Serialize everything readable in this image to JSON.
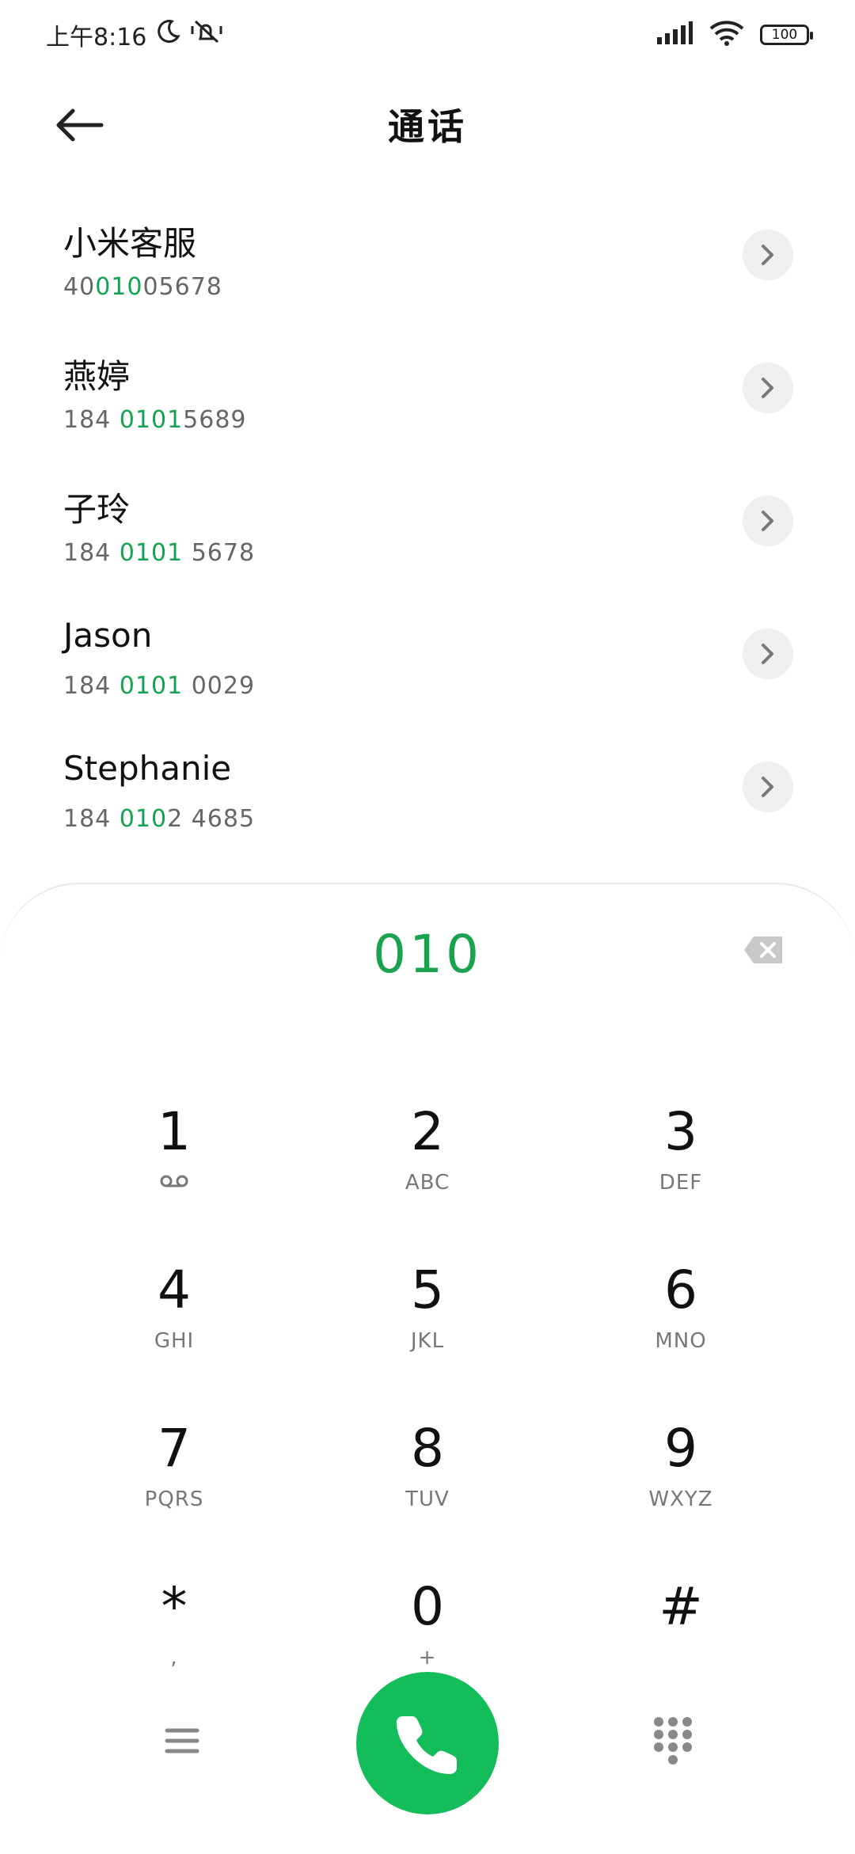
{
  "status_bar": {
    "time": "上午8:16",
    "battery": "100",
    "icons": [
      "moon-icon",
      "mute-icon",
      "signal-icon",
      "wifi-icon",
      "battery-icon"
    ]
  },
  "header": {
    "title": "通话"
  },
  "contacts": [
    {
      "name": "小米客服",
      "number_pre": "40",
      "number_match": "010",
      "number_post": "05678"
    },
    {
      "name": "燕婷",
      "number_pre": "184 ",
      "number_match": "0101",
      "number_post": "5689"
    },
    {
      "name": "子玲",
      "number_pre": "184 ",
      "number_match": "0101",
      "number_post": " 5678"
    },
    {
      "name": "Jason",
      "number_pre": "184 ",
      "number_match": "0101",
      "number_post": " 0029"
    },
    {
      "name": "Stephanie",
      "number_pre": "184 ",
      "number_match": "010",
      "number_post": "2 4685"
    }
  ],
  "dialpad": {
    "input": "010",
    "keys": [
      {
        "digit": "1",
        "letters": ""
      },
      {
        "digit": "2",
        "letters": "ABC"
      },
      {
        "digit": "3",
        "letters": "DEF"
      },
      {
        "digit": "4",
        "letters": "GHI"
      },
      {
        "digit": "5",
        "letters": "JKL"
      },
      {
        "digit": "6",
        "letters": "MNO"
      },
      {
        "digit": "7",
        "letters": "PQRS"
      },
      {
        "digit": "8",
        "letters": "TUV"
      },
      {
        "digit": "9",
        "letters": "WXYZ"
      },
      {
        "digit": "*",
        "letters": ","
      },
      {
        "digit": "0",
        "letters": "+"
      },
      {
        "digit": "#",
        "letters": ""
      }
    ]
  },
  "colors": {
    "accent": "#14a350",
    "call_button": "#13bd5a"
  }
}
